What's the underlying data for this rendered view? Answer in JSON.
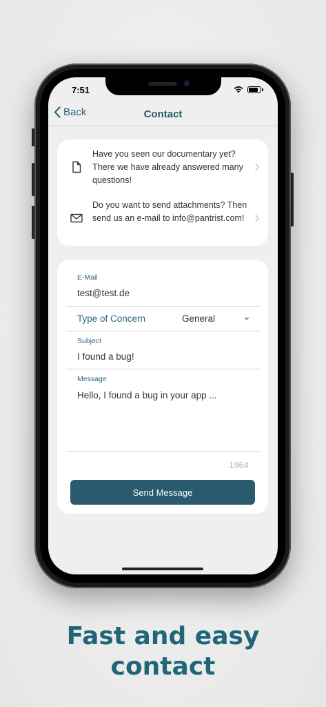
{
  "status": {
    "time": "7:51"
  },
  "nav": {
    "back_label": "Back",
    "title": "Contact"
  },
  "info": [
    {
      "icon": "document-icon",
      "text": "Have you seen our documentary yet? There we have already answered many questions!"
    },
    {
      "icon": "mail-icon",
      "text": "Do you want to send attachments? Then send us an e-mail to info@pantrist.com!"
    }
  ],
  "form": {
    "email_label": "E-Mail",
    "email_value": "test@test.de",
    "concern_label": "Type of Concern",
    "concern_value": "General",
    "subject_label": "Subject",
    "subject_value": "I found a bug!",
    "message_label": "Message",
    "message_value": "Hello, I found a bug in your app ...",
    "char_counter": "1964",
    "send_label": "Send Message"
  },
  "headline": {
    "line1": "Fast and easy",
    "line2": "contact"
  },
  "colors": {
    "accent": "#2d6680",
    "button": "#2a5a6d",
    "headline": "#1f6778"
  }
}
